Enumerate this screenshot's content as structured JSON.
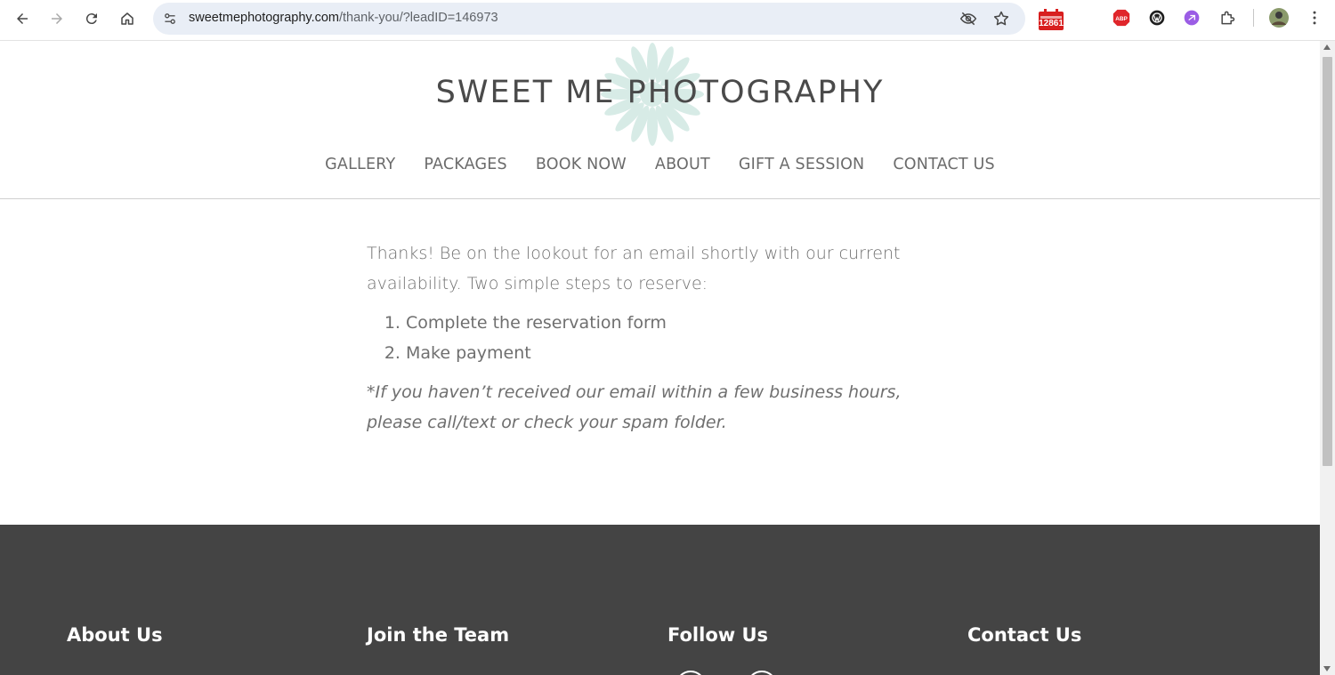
{
  "browser": {
    "url_host": "sweetmephotography.com",
    "url_path": "/thank-you/?leadID=146973",
    "extension_badge": "12861"
  },
  "site": {
    "title": "SWEET ME PHOTOGRAPHY",
    "nav": [
      "GALLERY",
      "PACKAGES",
      "BOOK NOW",
      "ABOUT",
      "GIFT A SESSION",
      "CONTACT US"
    ]
  },
  "content": {
    "lead": "Thanks! Be on the lookout for an email shortly with our current availability. Two simple steps to reserve:",
    "steps": [
      "Complete the reservation form",
      "Make payment"
    ],
    "note": "*If you haven’t received our email within a few business hours, please call/text or check your spam folder."
  },
  "footer": {
    "headings": [
      "About Us",
      "Join the Team",
      "Follow Us",
      "Contact Us"
    ]
  },
  "colors": {
    "footer_bg": "#444444",
    "logo_flower": "#d7ebe6",
    "body_text": "#6f6f6f"
  }
}
